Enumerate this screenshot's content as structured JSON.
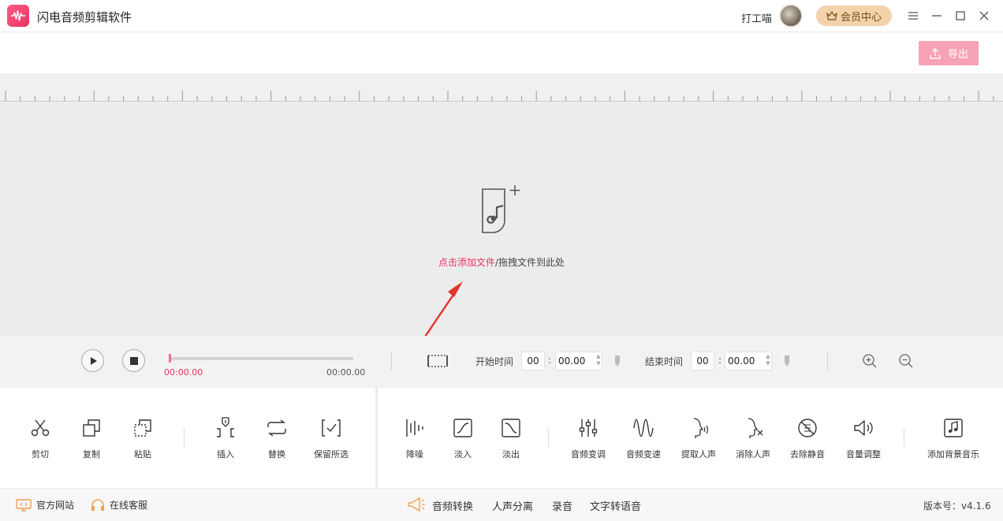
{
  "app": {
    "title": "闪电音频剪辑软件"
  },
  "user": {
    "name": "打工喵",
    "vip_label": "会员中心"
  },
  "export_label": "导出",
  "dropzone": {
    "link_text": "点击添加文件",
    "rest_text": "/拖拽文件到此处"
  },
  "playback": {
    "current_time": "00:00.00",
    "total_time": "00:00.00",
    "progress": 0
  },
  "selection": {
    "start_label": "开始时间",
    "start_min": "00",
    "start_sec": "00.00",
    "end_label": "结束时间",
    "end_min": "00",
    "end_sec": "00.00"
  },
  "tools": {
    "cut": "剪切",
    "copy": "复制",
    "paste": "粘贴",
    "insert": "插入",
    "replace": "替换",
    "keep_selection": "保留所选",
    "denoise": "降噪",
    "fade_in": "淡入",
    "fade_out": "淡出",
    "pitch": "音频变调",
    "speed": "音频变速",
    "extract_voice": "提取人声",
    "remove_voice": "消除人声",
    "remove_silence": "去除静音",
    "volume": "音量调整",
    "bg_music": "添加背景音乐"
  },
  "statusbar": {
    "website": "官方网站",
    "support": "在线客服",
    "convert": "音频转换",
    "separate": "人声分离",
    "record": "录音",
    "tts": "文字转语音",
    "version": "版本号：v4.1.6"
  },
  "colors": {
    "accent": "#e8335f",
    "export_bg": "#f7a3b5",
    "vip_bg": "#f3d2ac",
    "status_icon": "#f0a050"
  }
}
